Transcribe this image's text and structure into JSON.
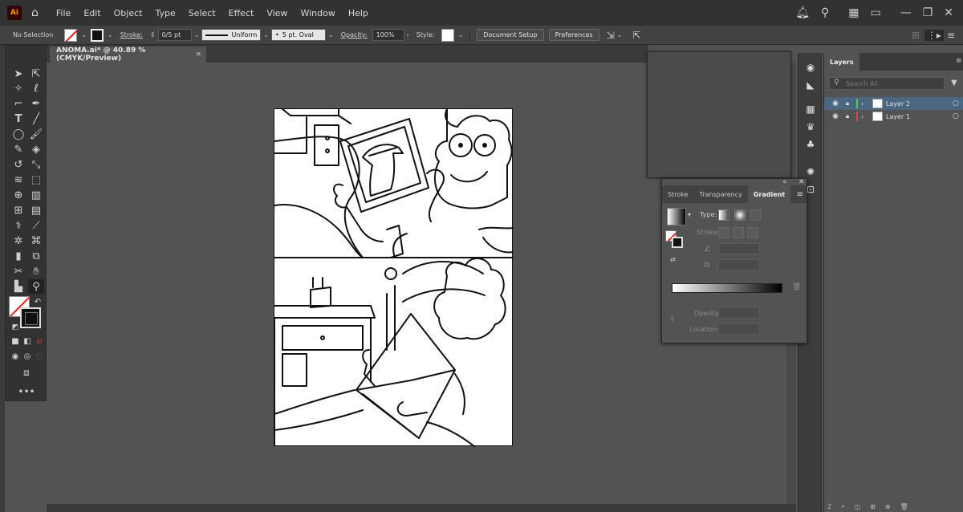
{
  "menubar": {
    "logo": "Ai",
    "items": [
      "File",
      "Edit",
      "Object",
      "Type",
      "Select",
      "Effect",
      "View",
      "Window",
      "Help"
    ]
  },
  "controlbar": {
    "selection": "No Selection",
    "stroke_label": "Stroke:",
    "stroke_value": "0/5 pt",
    "stroke_profile": "Uniform",
    "brush": "5 pt. Oval",
    "opacity_label": "Opacity:",
    "opacity_value": "100%",
    "style_label": "Style:",
    "document_setup": "Document Setup",
    "preferences": "Preferences"
  },
  "document": {
    "tab_title": "ANOMA.ai* @ 40.89 % (CMYK/Preview)",
    "close": "×"
  },
  "gradient_panel": {
    "tabs": [
      "Stroke",
      "Transparency",
      "Gradient"
    ],
    "active_tab": "Gradient",
    "type_label": "Type:",
    "stroke_label": "Stroke:",
    "opacity_label": "Opacity:",
    "location_label": "Location:"
  },
  "layers_panel": {
    "title": "Layers",
    "search_placeholder": "Search All",
    "layers": [
      {
        "name": "Layer 2",
        "color": "#3fd24a",
        "selected": true
      },
      {
        "name": "Layer 1",
        "color": "#e04545",
        "selected": false
      }
    ],
    "footer_count": "2"
  },
  "colors": {
    "ui_dark": "#323232",
    "canvas": "#535353",
    "selection_highlight": "#4b6680",
    "brand": "#ff9a00"
  }
}
